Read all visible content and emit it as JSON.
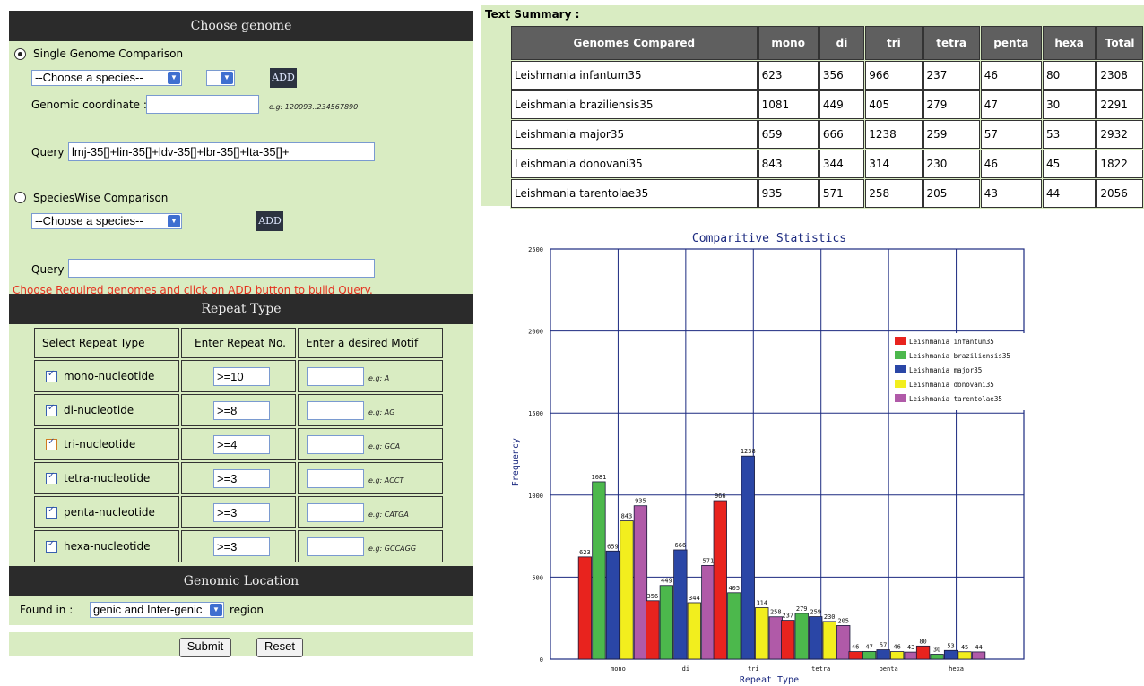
{
  "form": {
    "choose_genome_header": "Choose genome",
    "single_genome_label": "Single Genome Comparison",
    "species_select_value": "--Choose a species--",
    "small_select_value": "",
    "add_label": "ADD",
    "coord_label": "Genomic coordinate :",
    "coord_value": "",
    "coord_example": "e.g: 120093..234567890",
    "query_label": "Query",
    "query_value": "lmj-35[]+lin-35[]+ldv-35[]+lbr-35[]+lta-35[]+",
    "specieswise_label": "SpeciesWise Comparison",
    "species_select2_value": "--Choose a species--",
    "add2_label": "ADD",
    "query2_label": "Query",
    "query2_value": "",
    "instruction": "Choose Required genomes and click on ADD button to build Query.",
    "repeat_type_header": "Repeat Type",
    "repeat_columns": [
      "Select Repeat Type",
      "Enter Repeat No.",
      "Enter a desired Motif"
    ],
    "repeat_rows": [
      {
        "type": "mono-nucleotide",
        "no": ">=10",
        "example": "e.g: A"
      },
      {
        "type": "di-nucleotide",
        "no": ">=8",
        "example": "e.g: AG"
      },
      {
        "type": "tri-nucleotide",
        "no": ">=4",
        "example": "e.g: GCA"
      },
      {
        "type": "tetra-nucleotide",
        "no": ">=3",
        "example": "e.g: ACCT"
      },
      {
        "type": "penta-nucleotide",
        "no": ">=3",
        "example": "e.g: CATGA"
      },
      {
        "type": "hexa-nucleotide",
        "no": ">=3",
        "example": "e.g: GCCAGG"
      }
    ],
    "genomic_location_header": "Genomic Location",
    "found_in_label": "Found in :",
    "found_in_value": "genic and Inter-genic",
    "region_label": "region",
    "submit_label": "Submit",
    "reset_label": "Reset"
  },
  "summary": {
    "title": "Text Summary :",
    "headers": [
      "Genomes Compared",
      "mono",
      "di",
      "tri",
      "tetra",
      "penta",
      "hexa",
      "Total"
    ],
    "rows": [
      [
        "Leishmania infantum35",
        "623",
        "356",
        "966",
        "237",
        "46",
        "80",
        "2308"
      ],
      [
        "Leishmania braziliensis35",
        "1081",
        "449",
        "405",
        "279",
        "47",
        "30",
        "2291"
      ],
      [
        "Leishmania major35",
        "659",
        "666",
        "1238",
        "259",
        "57",
        "53",
        "2932"
      ],
      [
        "Leishmania donovani35",
        "843",
        "344",
        "314",
        "230",
        "46",
        "45",
        "1822"
      ],
      [
        "Leishmania tarentolae35",
        "935",
        "571",
        "258",
        "205",
        "43",
        "44",
        "2056"
      ]
    ]
  },
  "chart_data": {
    "type": "bar",
    "title": "Comparitive Statistics",
    "xlabel": "Repeat Type",
    "ylabel": "Frequency",
    "ylim": [
      0,
      2500
    ],
    "yticks": [
      0,
      500,
      1000,
      1500,
      2000,
      2500
    ],
    "categories": [
      "mono",
      "di",
      "tri",
      "tetra",
      "penta",
      "hexa"
    ],
    "grid": true,
    "legend_position": "top-right",
    "series": [
      {
        "name": "Leishmania infantum35",
        "color": "#e8231e",
        "values": [
          623,
          356,
          966,
          237,
          46,
          80
        ]
      },
      {
        "name": "Leishmania braziliensis35",
        "color": "#4cb84c",
        "values": [
          1081,
          449,
          405,
          279,
          47,
          30
        ]
      },
      {
        "name": "Leishmania major35",
        "color": "#2a46a6",
        "values": [
          659,
          666,
          1238,
          259,
          57,
          53
        ]
      },
      {
        "name": "Leishmania donovani35",
        "color": "#f2ee1e",
        "values": [
          843,
          344,
          314,
          230,
          46,
          45
        ]
      },
      {
        "name": "Leishmania tarentolae35",
        "color": "#b05aa8",
        "values": [
          935,
          571,
          258,
          205,
          43,
          44
        ]
      }
    ]
  },
  "colors": {
    "panel_green": "#d9ecc2",
    "header_dark": "#2b2b2b",
    "instruction_red": "#e5311f",
    "table_header_grey": "#5f5f5f"
  }
}
